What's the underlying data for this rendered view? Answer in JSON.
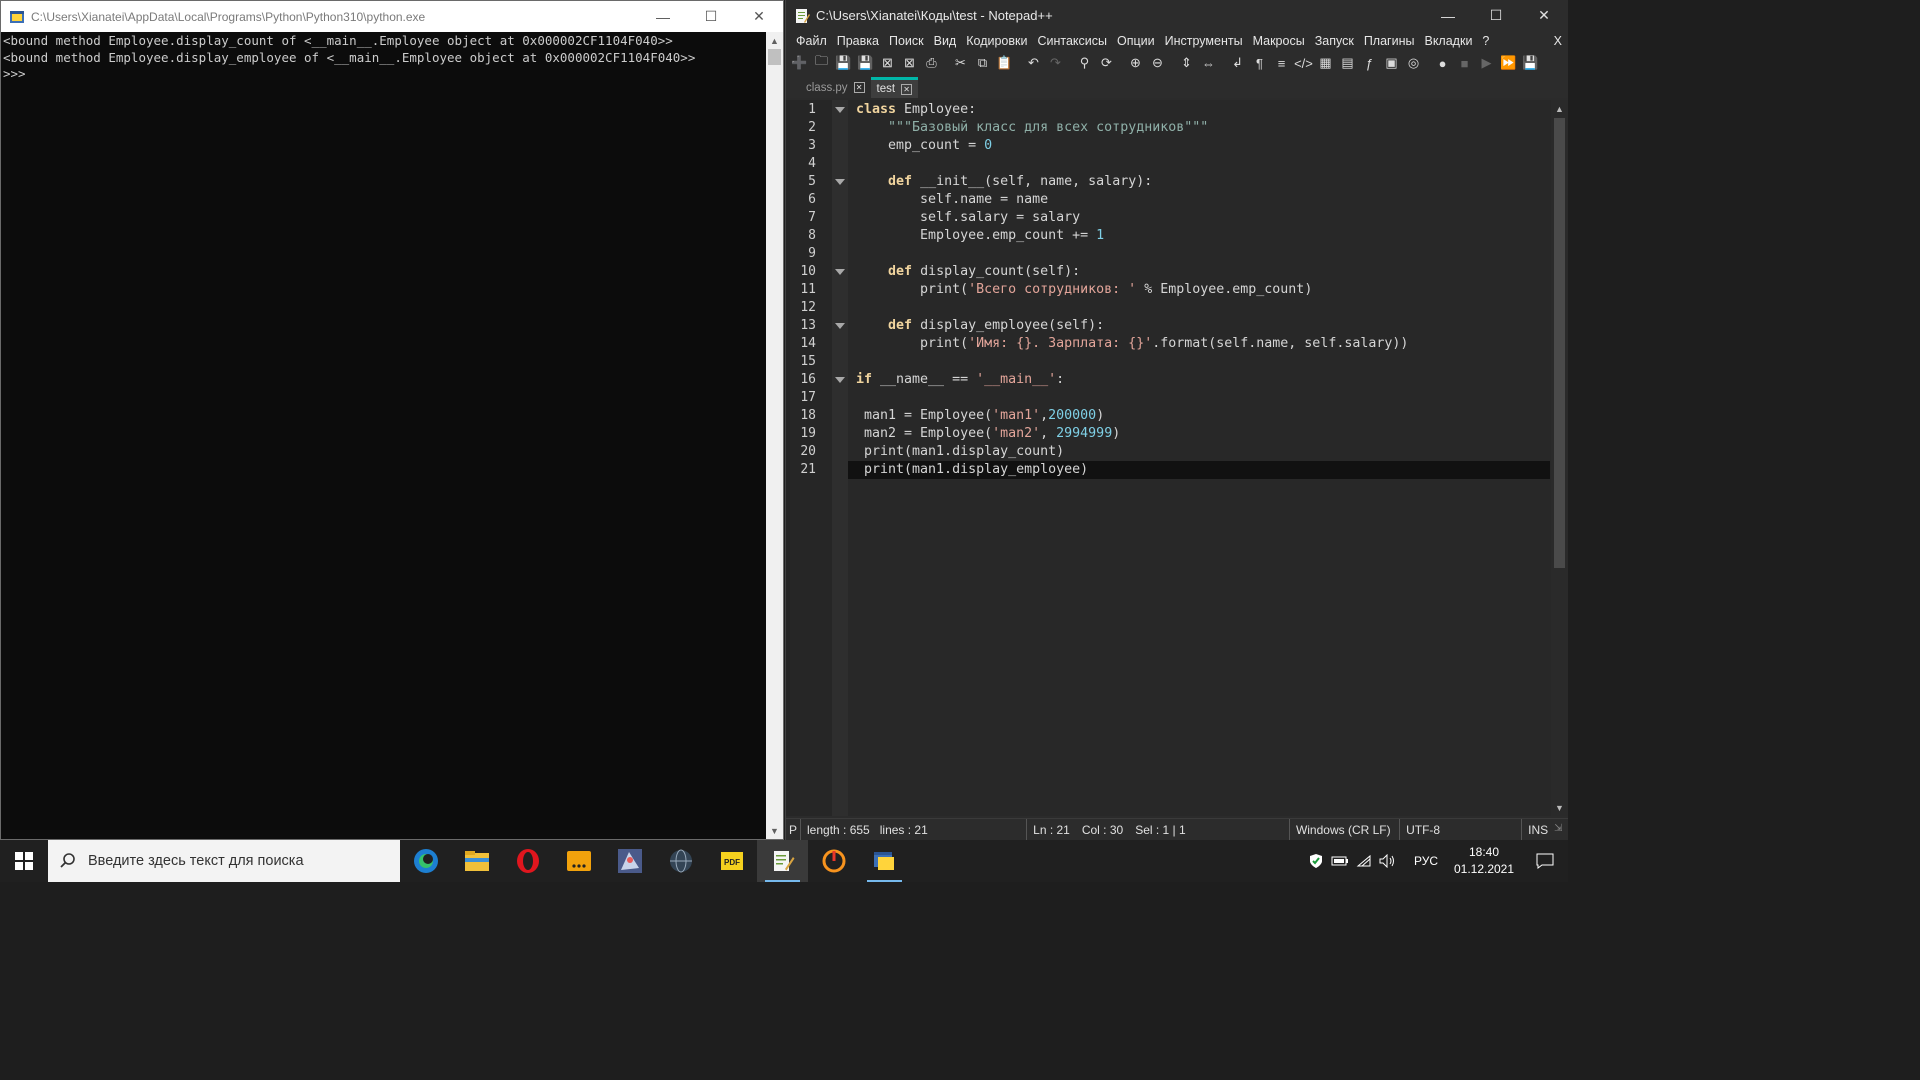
{
  "console": {
    "title": "C:\\Users\\Xianatei\\AppData\\Local\\Programs\\Python\\Python310\\python.exe",
    "output": "<bound method Employee.display_count of <__main__.Employee object at 0x000002CF1104F040>>\n<bound method Employee.display_employee of <__main__.Employee object at 0x000002CF1104F040>>\n>>>"
  },
  "notepad": {
    "title": "C:\\Users\\Xianatei\\Коды\\test - Notepad++",
    "menu": [
      "Файл",
      "Правка",
      "Поиск",
      "Вид",
      "Кодировки",
      "Синтаксисы",
      "Опции",
      "Инструменты",
      "Макросы",
      "Запуск",
      "Плагины",
      "Вкладки",
      "?"
    ],
    "menu_close": "X",
    "tabs": [
      {
        "label": "class.py",
        "active": false
      },
      {
        "label": "test",
        "active": true
      }
    ],
    "status": {
      "type": "P",
      "length": "length : 655",
      "lines": "lines : 21",
      "ln": "Ln : 21",
      "col": "Col : 30",
      "sel": "Sel : 1 | 1",
      "eol": "Windows (CR LF)",
      "encoding": "UTF-8",
      "mode": "INS"
    },
    "line_numbers": [
      "1",
      "2",
      "3",
      "4",
      "5",
      "6",
      "7",
      "8",
      "9",
      "10",
      "11",
      "12",
      "13",
      "14",
      "15",
      "16",
      "17",
      "18",
      "19",
      "20",
      "21"
    ],
    "code": [
      "class Employee:",
      "    \"\"\"Базовый класс для всех сотрудников\"\"\"",
      "    emp_count = 0",
      "",
      "    def __init__(self, name, salary):",
      "        self.name = name",
      "        self.salary = salary",
      "        Employee.emp_count += 1",
      "",
      "    def display_count(self):",
      "        print('Всего сотрудников: ' % Employee.emp_count)",
      "",
      "    def display_employee(self):",
      "        print('Имя: {}. Зарплата: {}'.format(self.name, self.salary))",
      "",
      "if __name__ == '__main__':",
      "",
      " man1 = Employee('man1',200000)",
      " man2 = Employee('man2', 2994999)",
      " print(man1.display_count)",
      " print(man1.display_employee)"
    ],
    "fold_lines": [
      1,
      5,
      10,
      13,
      16
    ],
    "current_line": 21
  },
  "taskbar": {
    "search_placeholder": "Введите здесь текст для поиска",
    "lang": "РУС",
    "time": "18:40",
    "date": "01.12.2021"
  },
  "colors": {
    "console_bg": "#0c0c0c",
    "editor_bg": "#282828",
    "tab_accent": "#00b7a8",
    "keyword": "#f0d49e",
    "string": "#e3a59a",
    "number": "#7fd0e6"
  }
}
